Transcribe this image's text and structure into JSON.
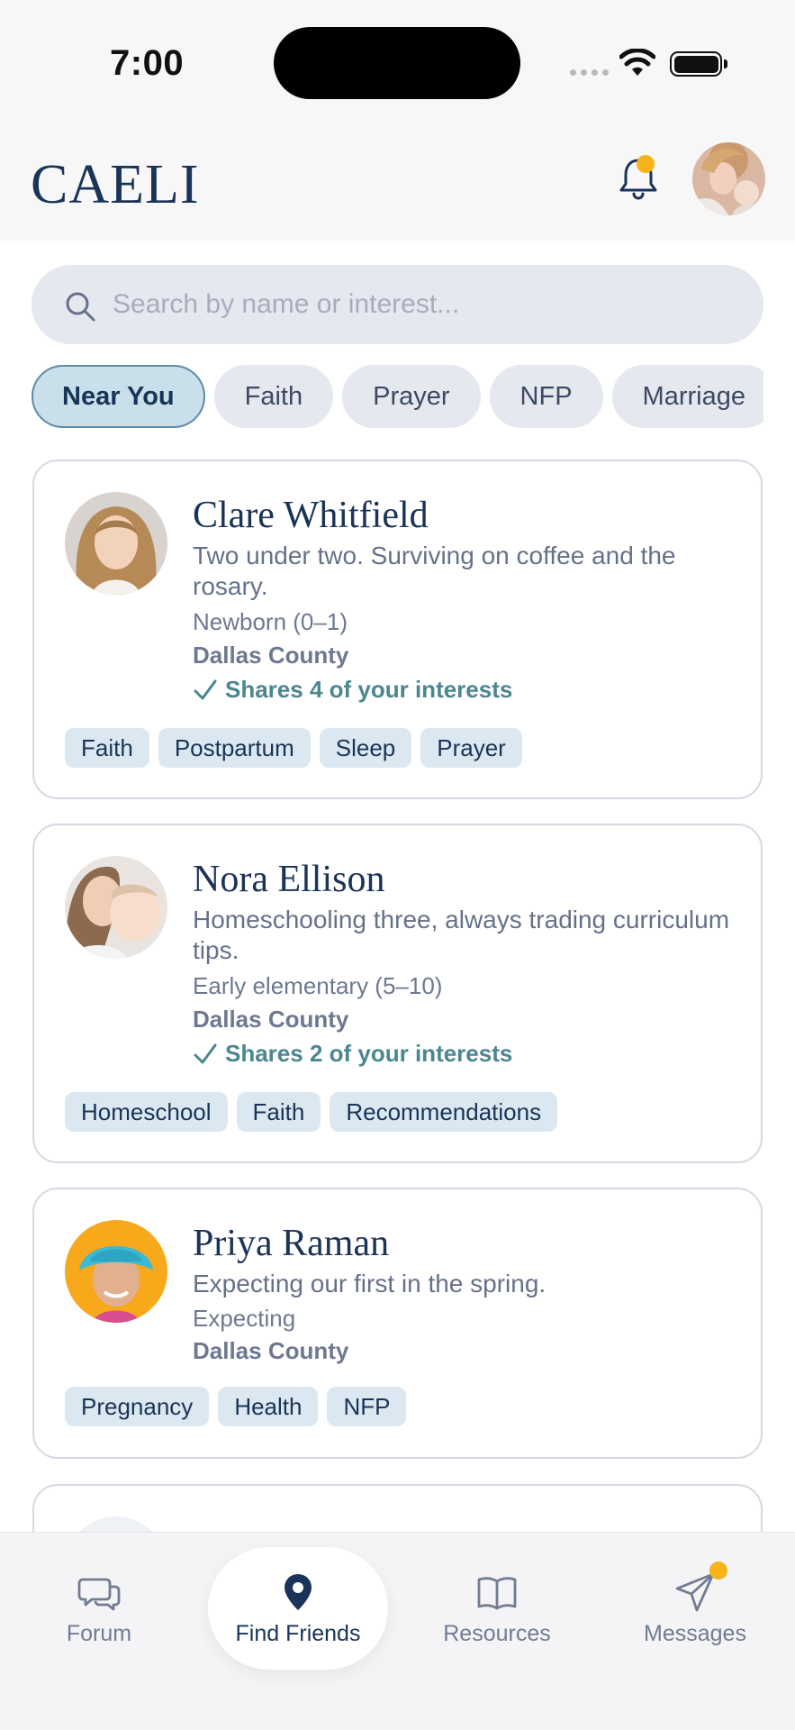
{
  "status_bar": {
    "time": "7:00"
  },
  "header": {
    "logo": "CAELI",
    "bell_icon": "bell-icon",
    "notification_badge_color": "#f6b418"
  },
  "search": {
    "placeholder": "Search by name or interest..."
  },
  "filters": [
    {
      "label": "Near You",
      "active": true
    },
    {
      "label": "Faith",
      "active": false
    },
    {
      "label": "Prayer",
      "active": false
    },
    {
      "label": "NFP",
      "active": false
    },
    {
      "label": "Marriage",
      "active": false
    }
  ],
  "profiles": [
    {
      "name": "Clare Whitfield",
      "bio": "Two under two. Surviving on coffee and the rosary.",
      "stage": "Newborn (0–1)",
      "location": "Dallas County",
      "shares": "Shares 4 of your interests",
      "tags": [
        "Faith",
        "Postpartum",
        "Sleep",
        "Prayer"
      ]
    },
    {
      "name": "Nora Ellison",
      "bio": "Homeschooling three, always trading curriculum tips.",
      "stage": "Early elementary (5–10)",
      "location": "Dallas County",
      "shares": "Shares 2 of your interests",
      "tags": [
        "Homeschool",
        "Faith",
        "Recommendations"
      ]
    },
    {
      "name": "Priya Raman",
      "bio": "Expecting our first in the spring.",
      "stage": "Expecting",
      "location": "Dallas County",
      "tags": [
        "Pregnancy",
        "Health",
        "NFP"
      ]
    }
  ],
  "nav": {
    "forum": "Forum",
    "find_friends": "Find Friends",
    "resources": "Resources",
    "messages": "Messages"
  },
  "colors": {
    "brand_navy": "#1a3358",
    "accent_teal": "#4b8691",
    "badge_yellow": "#f6b418"
  }
}
